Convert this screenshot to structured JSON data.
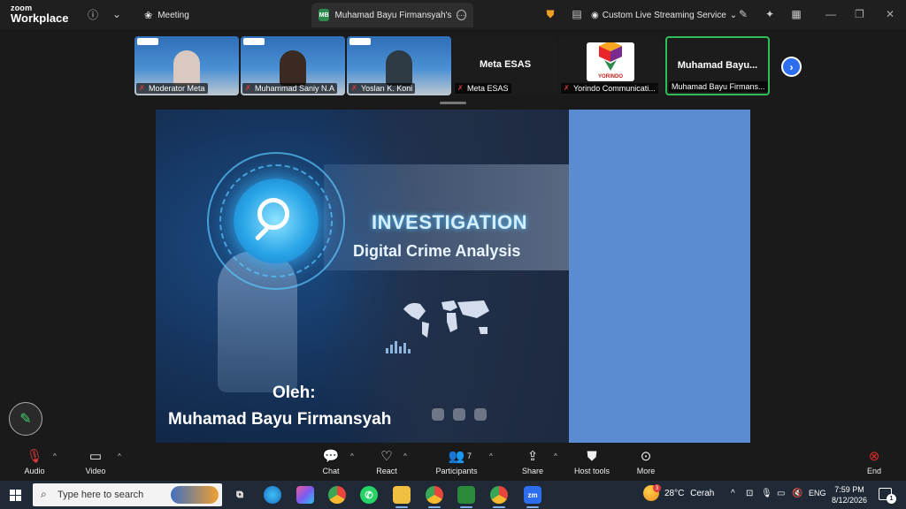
{
  "app": {
    "brand_line1": "zoom",
    "brand_line2": "Workplace"
  },
  "titlebar": {
    "meeting_tab": "Meeting",
    "share_tab_badge": "MB",
    "share_tab_label": "Muhamad Bayu Firmansyah's scr",
    "live_stream_label": "Custom Live Streaming Service"
  },
  "participants": [
    {
      "name": "Moderator Meta",
      "video": true,
      "muted": true
    },
    {
      "name": "Muhammad Saniy N.A",
      "video": true,
      "muted": true
    },
    {
      "name": "Yoslan K. Koni",
      "video": true,
      "muted": true
    },
    {
      "name": "Meta ESAS",
      "display_name": "Meta ESAS",
      "video": false,
      "muted": true
    },
    {
      "name": "Yorindo Communicati...",
      "logo_text": "YORINDO",
      "video": false,
      "muted": true
    },
    {
      "name": "Muhamad Bayu Firmans...",
      "display_name": "Muhamad  Bayu...",
      "video": false,
      "muted": false,
      "active": true
    }
  ],
  "slide": {
    "title": "INVESTIGATION",
    "subtitle": "Digital Crime Analysis",
    "by_label": "Oleh:",
    "author": "Muhamad Bayu Firmansyah"
  },
  "toolbar": {
    "audio": "Audio",
    "video": "Video",
    "chat": "Chat",
    "react": "React",
    "participants": "Participants",
    "participants_count": "7",
    "share": "Share",
    "host_tools": "Host tools",
    "more": "More",
    "end": "End"
  },
  "taskbar": {
    "search_placeholder": "Type here to search",
    "weather_temp": "28°C",
    "weather_desc": "Cerah",
    "weather_badge": "3",
    "language": "ENG",
    "time": "7:59 PM",
    "date": "8/12/2026",
    "notifications": "1"
  },
  "colors": {
    "active_speaker": "#2ebd59",
    "next_button": "#2d6ef0",
    "end_button": "#e02a2a",
    "muted_icon": "#e03b3b"
  }
}
